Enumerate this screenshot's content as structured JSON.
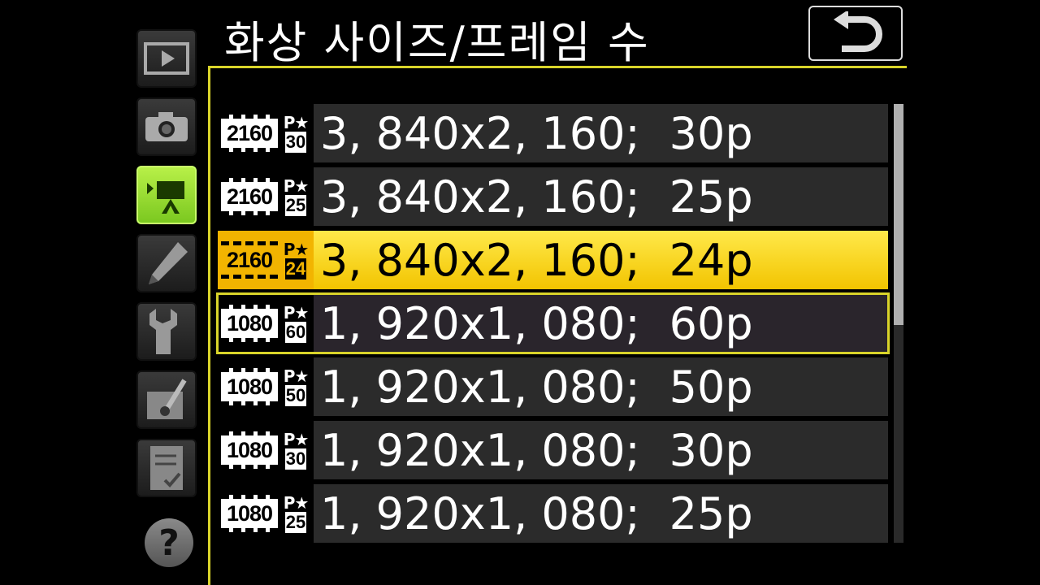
{
  "title": "화상 사이즈/프레임 수",
  "tabs": [
    {
      "name": "playback-menu-tab",
      "icon": "play-icon",
      "active": false
    },
    {
      "name": "photo-shooting-menu-tab",
      "icon": "camera-icon",
      "active": false
    },
    {
      "name": "movie-shooting-menu-tab",
      "icon": "movie-camera-icon",
      "active": true
    },
    {
      "name": "custom-settings-menu-tab",
      "icon": "pencil-icon",
      "active": false
    },
    {
      "name": "setup-menu-tab",
      "icon": "wrench-icon",
      "active": false
    },
    {
      "name": "retouch-menu-tab",
      "icon": "retouch-brush-icon",
      "active": false
    },
    {
      "name": "my-menu-tab",
      "icon": "checklist-icon",
      "active": false
    }
  ],
  "help_label": "?",
  "options": [
    {
      "res": "2160",
      "p": "P★",
      "fps": "30",
      "size": "3, 840x2, 160;",
      "rate": "30p",
      "state": "normal"
    },
    {
      "res": "2160",
      "p": "P★",
      "fps": "25",
      "size": "3, 840x2, 160;",
      "rate": "25p",
      "state": "normal"
    },
    {
      "res": "2160",
      "p": "P★",
      "fps": "24",
      "size": "3, 840x2, 160;",
      "rate": "24p",
      "state": "selected"
    },
    {
      "res": "1080",
      "p": "P★",
      "fps": "60",
      "size": "1, 920x1, 080;",
      "rate": "60p",
      "state": "cursor"
    },
    {
      "res": "1080",
      "p": "P★",
      "fps": "50",
      "size": "1, 920x1, 080;",
      "rate": "50p",
      "state": "normal"
    },
    {
      "res": "1080",
      "p": "P★",
      "fps": "30",
      "size": "1, 920x1, 080;",
      "rate": "30p",
      "state": "normal"
    },
    {
      "res": "1080",
      "p": "P★",
      "fps": "25",
      "size": "1, 920x1, 080;",
      "rate": "25p",
      "state": "normal"
    }
  ],
  "colors": {
    "highlight": "#f2c400",
    "accent_line": "#d9d42a",
    "active_tab": "#9be03a"
  }
}
